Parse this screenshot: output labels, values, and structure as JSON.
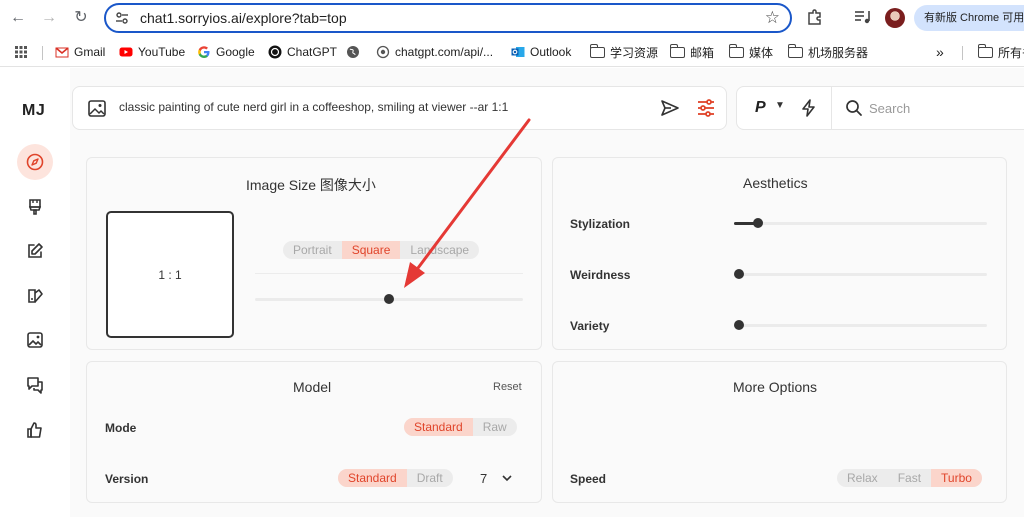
{
  "browser": {
    "url": "chat1.sorryios.ai/explore?tab=top",
    "update_label": "有新版 Chrome 可用",
    "bookmarks": [
      {
        "label": "Gmail",
        "icon": "gmail-icon"
      },
      {
        "label": "YouTube",
        "icon": "youtube-icon"
      },
      {
        "label": "Google",
        "icon": "google-icon"
      },
      {
        "label": "ChatGPT",
        "icon": "openai-icon"
      },
      {
        "label": "",
        "icon": "globe-icon"
      },
      {
        "label": "chatgpt.com/api/...",
        "icon": "globe-icon"
      },
      {
        "label": "Outlook",
        "icon": "outlook-icon"
      },
      {
        "label": "学习资源",
        "icon": "folder-icon"
      },
      {
        "label": "邮箱",
        "icon": "folder-icon"
      },
      {
        "label": "媒体",
        "icon": "folder-icon"
      },
      {
        "label": "机场服务器",
        "icon": "folder-icon"
      }
    ],
    "more_bookmarks": "»",
    "other_bookmarks": "所有书签"
  },
  "app": {
    "logo": "MJ",
    "prompt": "classic painting of cute nerd girl in a coffeeshop, smiling at viewer --ar 1:1",
    "mode_letter": "P",
    "search_placeholder": "Search"
  },
  "image_size": {
    "title": "Image Size  图像大小",
    "ratio": "1 : 1",
    "orientations": [
      "Portrait",
      "Square",
      "Landscape"
    ],
    "selected": "Square"
  },
  "aesthetics": {
    "title": "Aesthetics",
    "sliders": [
      {
        "label": "Stylization",
        "value": 0.1
      },
      {
        "label": "Weirdness",
        "value": 0
      },
      {
        "label": "Variety",
        "value": 0
      }
    ]
  },
  "model": {
    "title": "Model",
    "reset": "Reset",
    "mode_label": "Mode",
    "mode_options": [
      "Standard",
      "Raw"
    ],
    "mode_selected": "Standard",
    "version_label": "Version",
    "version_options": [
      "Standard",
      "Draft"
    ],
    "version_selected": "Standard",
    "version_number": "7"
  },
  "more_options": {
    "title": "More Options",
    "speed_label": "Speed",
    "speed_options": [
      "Relax",
      "Fast",
      "Turbo"
    ],
    "speed_selected": "Turbo"
  },
  "colors": {
    "accent": "#e0442a",
    "accent_bg": "#fbd5cb",
    "annotation_arrow": "#e53935"
  }
}
